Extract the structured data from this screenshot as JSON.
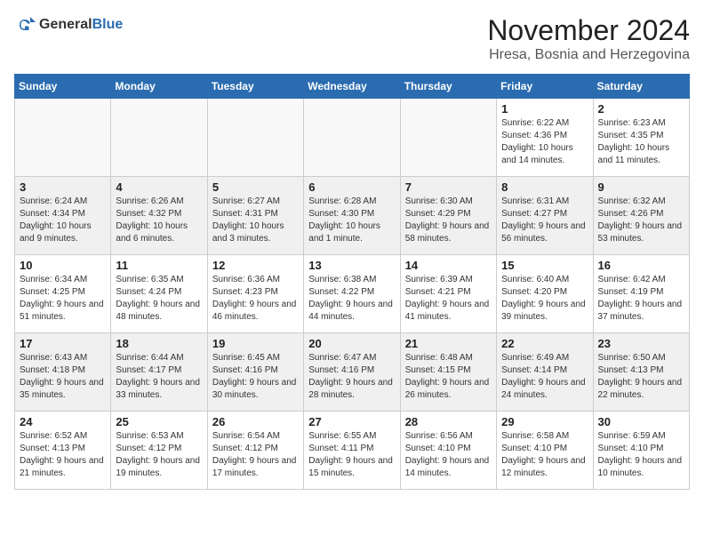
{
  "header": {
    "logo_general": "General",
    "logo_blue": "Blue",
    "month_title": "November 2024",
    "location": "Hresa, Bosnia and Herzegovina"
  },
  "weekdays": [
    "Sunday",
    "Monday",
    "Tuesday",
    "Wednesday",
    "Thursday",
    "Friday",
    "Saturday"
  ],
  "weeks": [
    [
      {
        "day": "",
        "info": ""
      },
      {
        "day": "",
        "info": ""
      },
      {
        "day": "",
        "info": ""
      },
      {
        "day": "",
        "info": ""
      },
      {
        "day": "",
        "info": ""
      },
      {
        "day": "1",
        "info": "Sunrise: 6:22 AM\nSunset: 4:36 PM\nDaylight: 10 hours and 14 minutes."
      },
      {
        "day": "2",
        "info": "Sunrise: 6:23 AM\nSunset: 4:35 PM\nDaylight: 10 hours and 11 minutes."
      }
    ],
    [
      {
        "day": "3",
        "info": "Sunrise: 6:24 AM\nSunset: 4:34 PM\nDaylight: 10 hours and 9 minutes."
      },
      {
        "day": "4",
        "info": "Sunrise: 6:26 AM\nSunset: 4:32 PM\nDaylight: 10 hours and 6 minutes."
      },
      {
        "day": "5",
        "info": "Sunrise: 6:27 AM\nSunset: 4:31 PM\nDaylight: 10 hours and 3 minutes."
      },
      {
        "day": "6",
        "info": "Sunrise: 6:28 AM\nSunset: 4:30 PM\nDaylight: 10 hours and 1 minute."
      },
      {
        "day": "7",
        "info": "Sunrise: 6:30 AM\nSunset: 4:29 PM\nDaylight: 9 hours and 58 minutes."
      },
      {
        "day": "8",
        "info": "Sunrise: 6:31 AM\nSunset: 4:27 PM\nDaylight: 9 hours and 56 minutes."
      },
      {
        "day": "9",
        "info": "Sunrise: 6:32 AM\nSunset: 4:26 PM\nDaylight: 9 hours and 53 minutes."
      }
    ],
    [
      {
        "day": "10",
        "info": "Sunrise: 6:34 AM\nSunset: 4:25 PM\nDaylight: 9 hours and 51 minutes."
      },
      {
        "day": "11",
        "info": "Sunrise: 6:35 AM\nSunset: 4:24 PM\nDaylight: 9 hours and 48 minutes."
      },
      {
        "day": "12",
        "info": "Sunrise: 6:36 AM\nSunset: 4:23 PM\nDaylight: 9 hours and 46 minutes."
      },
      {
        "day": "13",
        "info": "Sunrise: 6:38 AM\nSunset: 4:22 PM\nDaylight: 9 hours and 44 minutes."
      },
      {
        "day": "14",
        "info": "Sunrise: 6:39 AM\nSunset: 4:21 PM\nDaylight: 9 hours and 41 minutes."
      },
      {
        "day": "15",
        "info": "Sunrise: 6:40 AM\nSunset: 4:20 PM\nDaylight: 9 hours and 39 minutes."
      },
      {
        "day": "16",
        "info": "Sunrise: 6:42 AM\nSunset: 4:19 PM\nDaylight: 9 hours and 37 minutes."
      }
    ],
    [
      {
        "day": "17",
        "info": "Sunrise: 6:43 AM\nSunset: 4:18 PM\nDaylight: 9 hours and 35 minutes."
      },
      {
        "day": "18",
        "info": "Sunrise: 6:44 AM\nSunset: 4:17 PM\nDaylight: 9 hours and 33 minutes."
      },
      {
        "day": "19",
        "info": "Sunrise: 6:45 AM\nSunset: 4:16 PM\nDaylight: 9 hours and 30 minutes."
      },
      {
        "day": "20",
        "info": "Sunrise: 6:47 AM\nSunset: 4:16 PM\nDaylight: 9 hours and 28 minutes."
      },
      {
        "day": "21",
        "info": "Sunrise: 6:48 AM\nSunset: 4:15 PM\nDaylight: 9 hours and 26 minutes."
      },
      {
        "day": "22",
        "info": "Sunrise: 6:49 AM\nSunset: 4:14 PM\nDaylight: 9 hours and 24 minutes."
      },
      {
        "day": "23",
        "info": "Sunrise: 6:50 AM\nSunset: 4:13 PM\nDaylight: 9 hours and 22 minutes."
      }
    ],
    [
      {
        "day": "24",
        "info": "Sunrise: 6:52 AM\nSunset: 4:13 PM\nDaylight: 9 hours and 21 minutes."
      },
      {
        "day": "25",
        "info": "Sunrise: 6:53 AM\nSunset: 4:12 PM\nDaylight: 9 hours and 19 minutes."
      },
      {
        "day": "26",
        "info": "Sunrise: 6:54 AM\nSunset: 4:12 PM\nDaylight: 9 hours and 17 minutes."
      },
      {
        "day": "27",
        "info": "Sunrise: 6:55 AM\nSunset: 4:11 PM\nDaylight: 9 hours and 15 minutes."
      },
      {
        "day": "28",
        "info": "Sunrise: 6:56 AM\nSunset: 4:10 PM\nDaylight: 9 hours and 14 minutes."
      },
      {
        "day": "29",
        "info": "Sunrise: 6:58 AM\nSunset: 4:10 PM\nDaylight: 9 hours and 12 minutes."
      },
      {
        "day": "30",
        "info": "Sunrise: 6:59 AM\nSunset: 4:10 PM\nDaylight: 9 hours and 10 minutes."
      }
    ]
  ]
}
